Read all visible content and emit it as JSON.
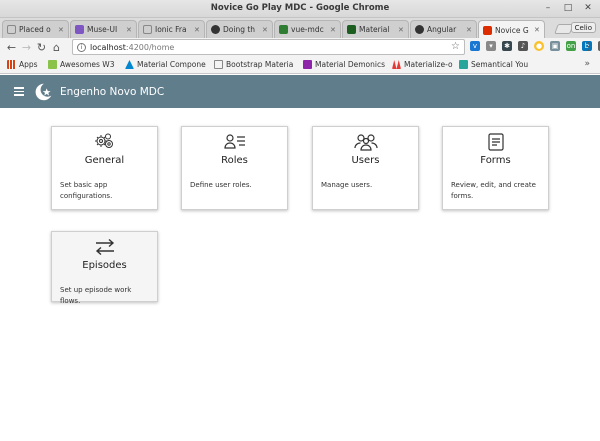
{
  "window": {
    "title": "Novice Go Play MDC - Google Chrome"
  },
  "tabs": [
    {
      "label": "Placed o",
      "color": "#ffffff"
    },
    {
      "label": "Muse-UI",
      "color": "#7e57c2"
    },
    {
      "label": "Ionic Fra",
      "color": "#ffffff"
    },
    {
      "label": "Doing th",
      "color": "#333333"
    },
    {
      "label": "vue-mdc",
      "color": "#2e7d32"
    },
    {
      "label": "Material",
      "color": "#1b5e20"
    },
    {
      "label": "Angular",
      "color": "#333333"
    },
    {
      "label": "Novice G",
      "color": "#dd2c00"
    }
  ],
  "profile": "Celio",
  "address": {
    "host": "localhost",
    "path": ":4200/home"
  },
  "bookmarks": [
    {
      "label": "Apps",
      "color": "#d84315"
    },
    {
      "label": "Awesomes W3",
      "color": "#8bc34a"
    },
    {
      "label": "Material Compone",
      "color": "#0288d1"
    },
    {
      "label": "Bootstrap Materia",
      "color": "#ffffff"
    },
    {
      "label": "Material Demonics",
      "color": "#8e24aa"
    },
    {
      "label": "Materialize-o",
      "color": "#e53935"
    },
    {
      "label": "Semantical You",
      "color": "#26a69a"
    }
  ],
  "app": {
    "title": "Engenho Novo MDC",
    "bar_color": "#607d8b"
  },
  "cards": [
    {
      "title": "General",
      "description": "Set basic app configurations.",
      "icon": "settings-icon"
    },
    {
      "title": "Roles",
      "description": "Define user roles.",
      "icon": "assignment-ind-icon"
    },
    {
      "title": "Users",
      "description": "Manage users.",
      "icon": "people-icon"
    },
    {
      "title": "Forms",
      "description": "Review, edit, and create forms.",
      "icon": "form-icon"
    },
    {
      "title": "Episodes",
      "description": "Set up episode work flows.",
      "icon": "swap-horiz-icon"
    }
  ]
}
